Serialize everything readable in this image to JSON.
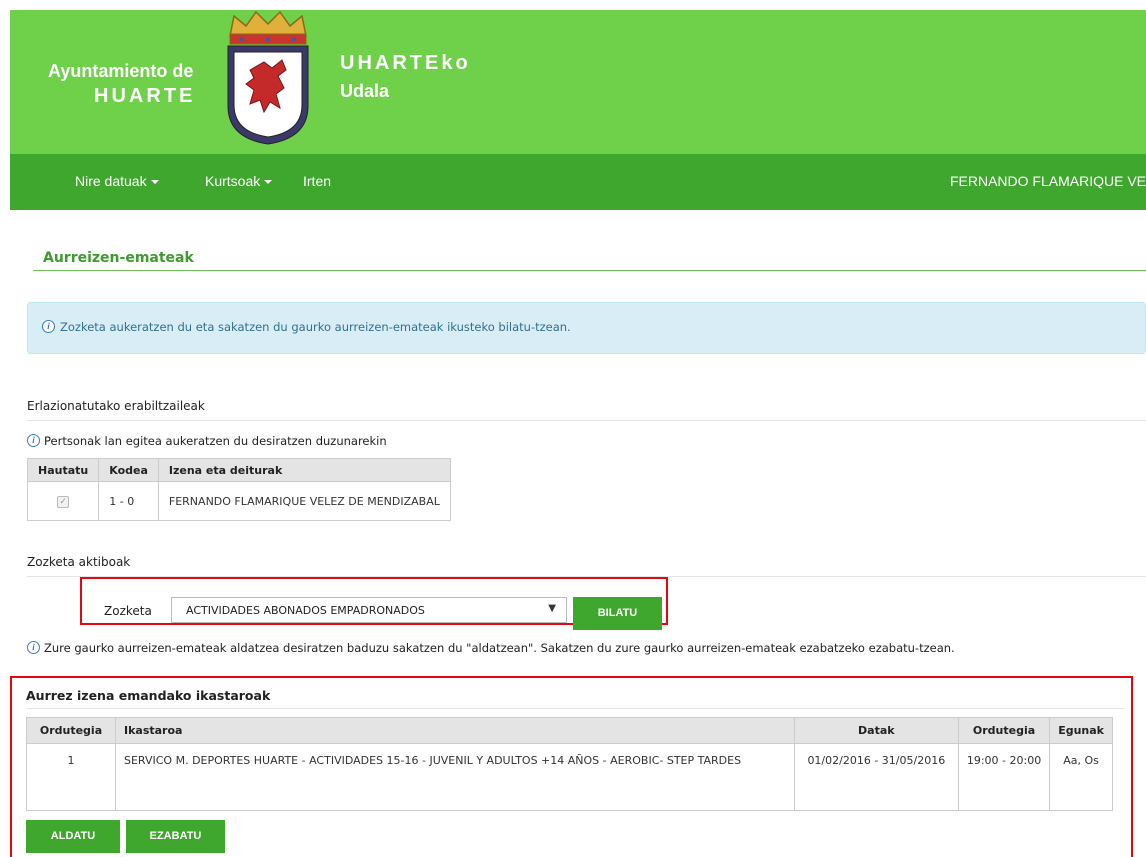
{
  "header": {
    "left_line1": "Ayuntamiento de",
    "left_line2": "HUARTE",
    "right_line1": "UHARTEko",
    "right_line2": "Udala"
  },
  "nav": {
    "items": [
      {
        "label": "Nire datuak",
        "dropdown": true
      },
      {
        "label": "Kurtsoak",
        "dropdown": true
      },
      {
        "label": "Irten",
        "dropdown": false
      }
    ],
    "user": "FERNANDO FLAMARIQUE VE"
  },
  "page": {
    "title": "Aurreizen-emateak",
    "alert": "Zozketa aukeratzen du eta sakatzen du gaurko aurreizen-emateak ikusteko bilatu-tzean."
  },
  "users_section": {
    "title": "Erlazionatutako erabiltzaileak",
    "hint": "Pertsonak lan egitea aukeratzen du desiratzen duzunarekin",
    "columns": [
      "Hautatu",
      "Kodea",
      "Izena eta deiturak"
    ],
    "rows": [
      {
        "checked": true,
        "code": "1 - 0",
        "name": "FERNANDO FLAMARIQUE VELEZ DE MENDIZABAL"
      }
    ]
  },
  "draw_section": {
    "title": "Zozketa aktiboak",
    "label": "Zozketa",
    "selected": "ACTIVIDADES ABONADOS EMPADRONADOS",
    "search_button": "BILATU",
    "hint": "Zure gaurko aurreizen-emateak aldatzea desiratzen baduzu sakatzen du \"aldatzean\". Sakatzen du zure gaurko aurreizen-emateak ezabatzeko ezabatu-tzean."
  },
  "courses_section": {
    "title": "Aurrez izena emandako ikastaroak",
    "columns": [
      "Ordutegia",
      "Ikastaroa",
      "Datak",
      "Ordutegia",
      "Egunak"
    ],
    "rows": [
      {
        "n": "1",
        "course": "SERVICO M. DEPORTES HUARTE - ACTIVIDADES 15-16 - JUVENIL Y ADULTOS +14 AÑOS - AEROBIC- STEP TARDES",
        "dates": "01/02/2016 - 31/05/2016",
        "time": "19:00 - 20:00",
        "days": "Aa, Os"
      }
    ],
    "modify_button": "ALDATU",
    "delete_button": "EZABATU"
  },
  "colors": {
    "header_green": "#6fd04a",
    "nav_green": "#3fa62e",
    "highlight_red": "#e30613",
    "alert_bg": "#d9edf7"
  }
}
